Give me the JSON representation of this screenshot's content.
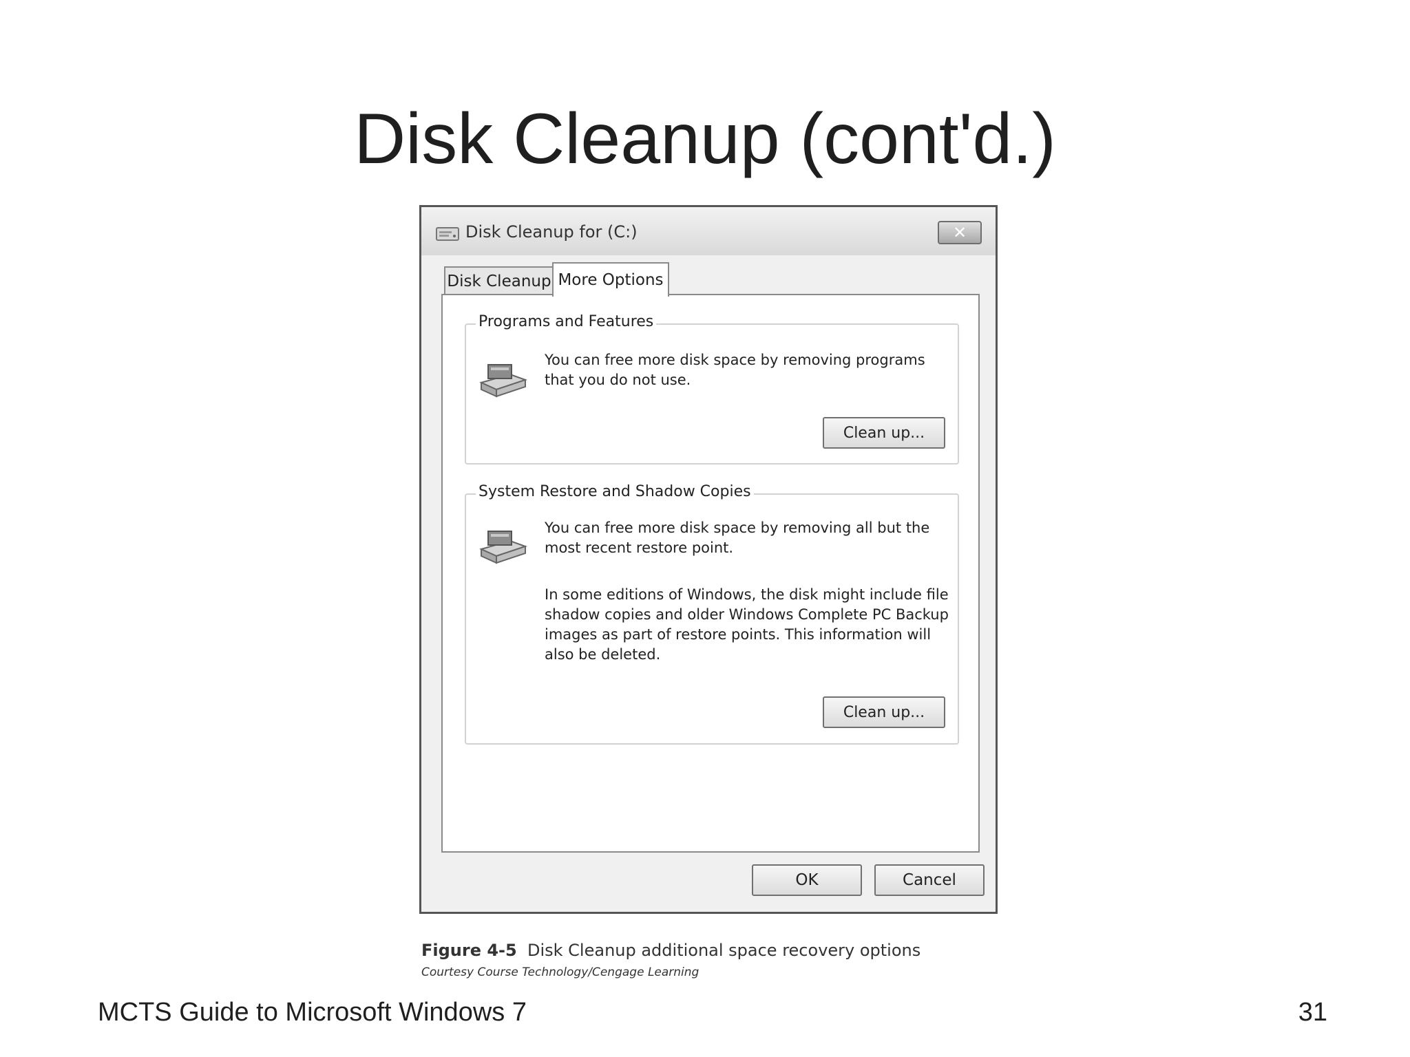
{
  "slide": {
    "title": "Disk Cleanup (cont'd.)",
    "footer_left": "MCTS Guide to Microsoft Windows 7",
    "page_number": "31"
  },
  "dialog": {
    "title": "Disk Cleanup for  (C:)",
    "title_icon": "drive-icon",
    "close_glyph": "✕",
    "tabs": [
      {
        "label": "Disk Cleanup",
        "selected": false
      },
      {
        "label": "More Options",
        "selected": true
      }
    ],
    "groups": [
      {
        "title": "Programs and Features",
        "icon": "programs-drive-icon",
        "paragraphs": [
          "You can free more disk space by removing programs that you do not use."
        ],
        "button_label": "Clean up..."
      },
      {
        "title": "System Restore and Shadow Copies",
        "icon": "restore-drive-icon",
        "paragraphs": [
          "You can free more disk space by removing all but the most recent restore point.",
          "In some editions of Windows, the disk might include file shadow copies and older Windows Complete PC Backup images as part of restore points. This information will also be deleted."
        ],
        "button_label": "Clean up..."
      }
    ],
    "ok_label": "OK",
    "cancel_label": "Cancel"
  },
  "figure": {
    "label": "Figure 4-5",
    "caption": "Disk Cleanup additional space recovery options",
    "courtesy": "Courtesy Course Technology/Cengage Learning"
  }
}
